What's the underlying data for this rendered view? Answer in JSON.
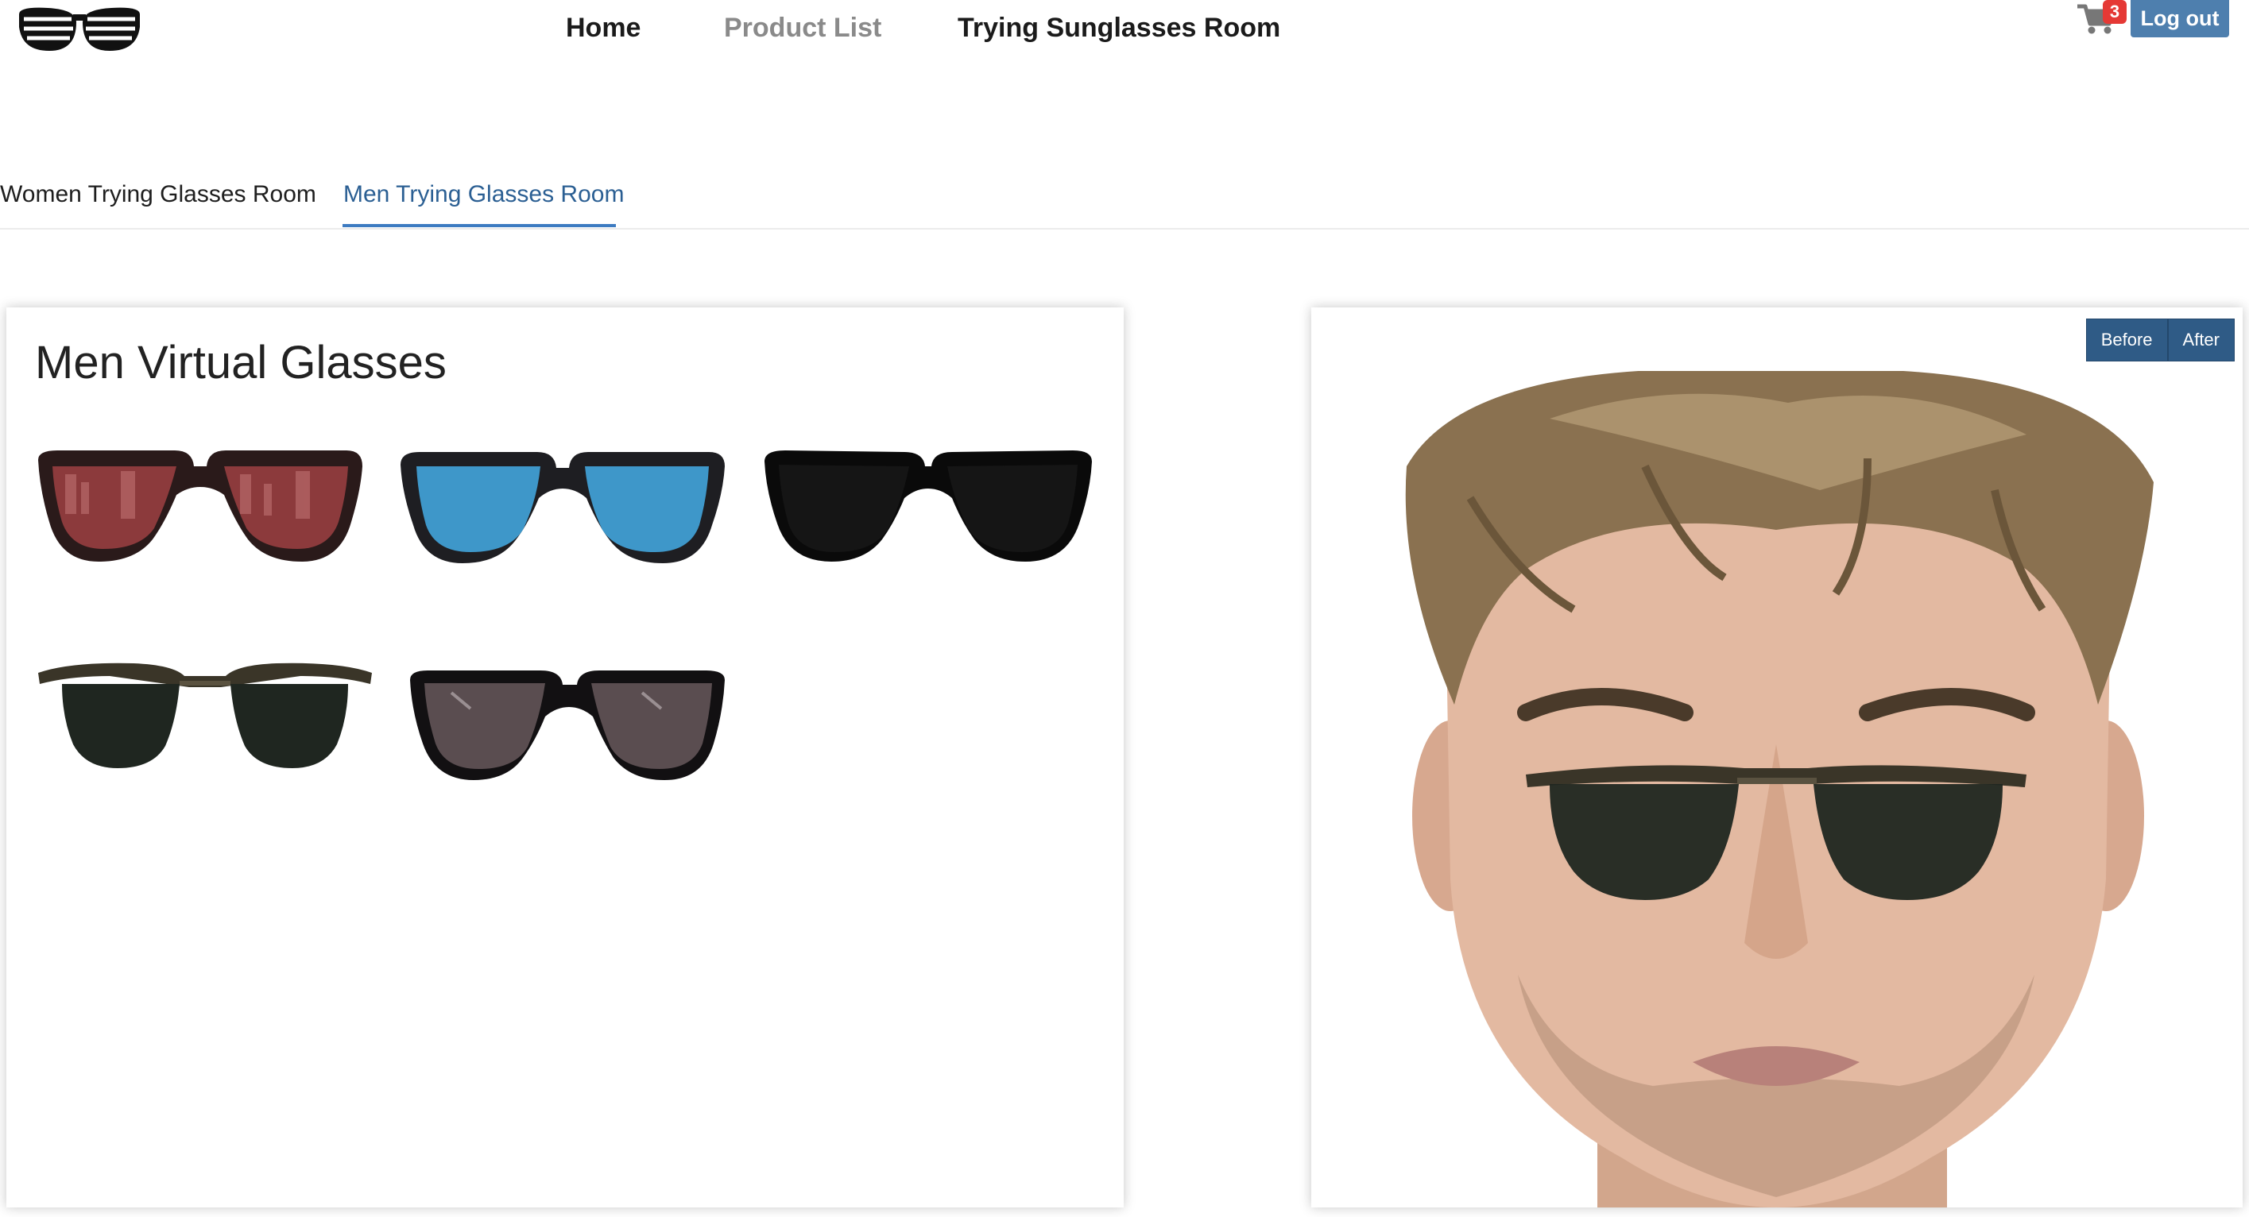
{
  "header": {
    "logo_icon": "sunglasses-logo-icon",
    "nav": {
      "home": "Home",
      "product_list": "Product List",
      "trying_room": "Trying Sunglasses Room"
    },
    "cart_icon": "shopping-cart-icon",
    "cart_count": "3",
    "logout": "Log out"
  },
  "tabs": {
    "women": "Women Trying Glasses Room",
    "men": "Men Trying Glasses Room",
    "active": "men"
  },
  "gallery": {
    "title": "Men Virtual Glasses",
    "items": [
      {
        "name": "Red mirrored wayfarer",
        "lens_color": "#8c3a3c",
        "frame_color": "#2a1a1a"
      },
      {
        "name": "Blue lens wayfarer",
        "lens_color": "#3e97c9",
        "frame_color": "#1e1e22"
      },
      {
        "name": "All-black wayfarer",
        "lens_color": "#151515",
        "frame_color": "#0a0a0a"
      },
      {
        "name": "Clubmaster dark green",
        "lens_color": "#1f2620",
        "frame_color": "#3a3528"
      },
      {
        "name": "Grey gradient wayfarer",
        "lens_color": "#5a4d50",
        "frame_color": "#121012"
      }
    ]
  },
  "preview": {
    "before": "Before",
    "after": "After",
    "selected_glasses": "Clubmaster dark green"
  },
  "colors": {
    "accent": "#3d7bc1",
    "logout_bg": "#4e7fae",
    "toggle_bg": "#2f5b86",
    "badge": "#e53935"
  }
}
